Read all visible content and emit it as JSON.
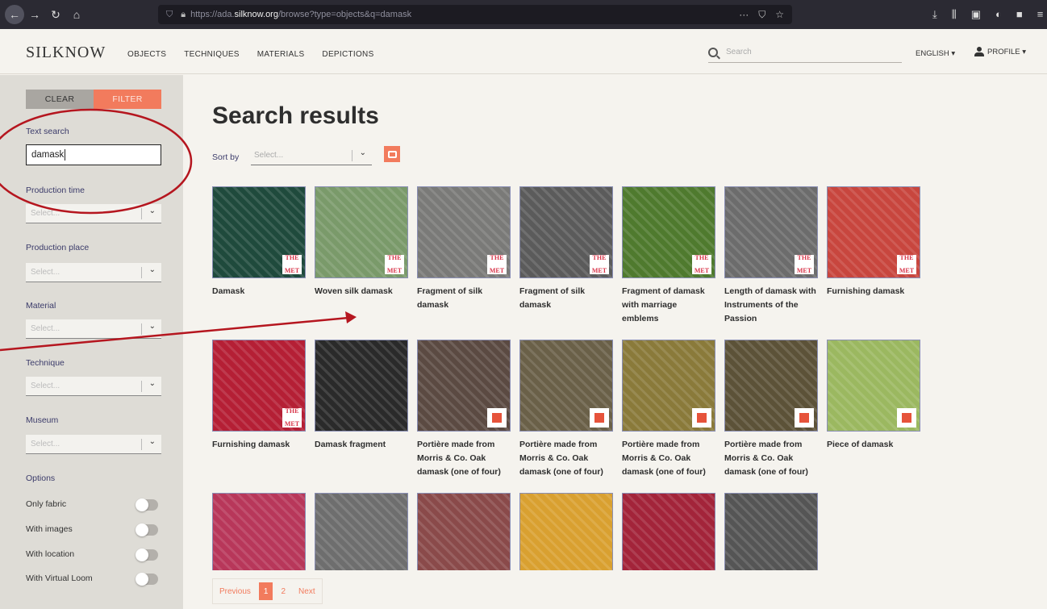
{
  "browser": {
    "url_prefix": "https://ada.",
    "url_host": "silknow.org",
    "url_rest": "/browse?type=objects&q=damask"
  },
  "header": {
    "logo": "SILKNOW",
    "nav": [
      "OBJECTS",
      "TECHNIQUES",
      "MATERIALS",
      "DEPICTIONS"
    ],
    "search_placeholder": "Search",
    "language": "ENGLISH ▾",
    "profile": "PROFILE ▾"
  },
  "sidebar": {
    "clear": "CLEAR",
    "filter": "FILTER",
    "text_search_label": "Text search",
    "text_search_value": "damask",
    "filters": [
      {
        "label": "Production time",
        "placeholder": "Select..."
      },
      {
        "label": "Production place",
        "placeholder": "Select..."
      },
      {
        "label": "Material",
        "placeholder": "Select..."
      },
      {
        "label": "Technique",
        "placeholder": "Select..."
      },
      {
        "label": "Museum",
        "placeholder": "Select..."
      }
    ],
    "options_label": "Options",
    "options": [
      "Only fabric",
      "With images",
      "With location",
      "With Virtual Loom"
    ]
  },
  "main": {
    "title": "Search results",
    "sort_label": "Sort by",
    "sort_placeholder": "Select...",
    "results": [
      {
        "title": "Damask",
        "badge": "met",
        "color": "#1f4a3c"
      },
      {
        "title": "Woven silk damask",
        "badge": "met",
        "color": "#7a9a6a"
      },
      {
        "title": "Fragment of silk damask",
        "badge": "met",
        "color": "#7a7a78"
      },
      {
        "title": "Fragment of silk damask",
        "badge": "met",
        "color": "#5b5b5b"
      },
      {
        "title": "Fragment of damask with marriage emblems",
        "badge": "met",
        "color": "#4f7a2e"
      },
      {
        "title": "Length of damask with Instruments of the Passion",
        "badge": "met",
        "color": "#6c6c6c"
      },
      {
        "title": "Furnishing damask",
        "badge": "met",
        "color": "#c8463e"
      },
      {
        "title": "Furnishing damask",
        "badge": "met",
        "color": "#b51f35"
      },
      {
        "title": "Damask fragment",
        "badge": "none",
        "color": "#2a2a2a"
      },
      {
        "title": "Portière made from Morris & Co. Oak damask (one of four)",
        "badge": "vam",
        "color": "#5b4a42"
      },
      {
        "title": "Portière made from Morris & Co. Oak damask (one of four)",
        "badge": "vam",
        "color": "#6a6048"
      },
      {
        "title": "Portière made from Morris & Co. Oak damask (one of four)",
        "badge": "vam",
        "color": "#8a7a3a"
      },
      {
        "title": "Portière made from Morris & Co. Oak damask (one of four)",
        "badge": "vam",
        "color": "#5c5238"
      },
      {
        "title": "Piece of damask",
        "badge": "vam",
        "color": "#9bb860"
      },
      {
        "title": "",
        "badge": "none",
        "color": "#b8375a"
      },
      {
        "title": "",
        "badge": "none",
        "color": "#6e6e6e"
      },
      {
        "title": "",
        "badge": "none",
        "color": "#8a4a4a"
      },
      {
        "title": "",
        "badge": "none",
        "color": "#d9a030"
      },
      {
        "title": "",
        "badge": "none",
        "color": "#a3243a"
      },
      {
        "title": "",
        "badge": "none",
        "color": "#555555"
      }
    ],
    "met_line1": "THE",
    "met_line2": "MET",
    "pagination": {
      "prev": "Previous",
      "pages": [
        "1",
        "2"
      ],
      "next": "Next"
    }
  },
  "colors": {
    "accent": "#f27b5d",
    "annotation": "#b5161f",
    "sidebar_bg": "#dedcd6",
    "page_bg": "#f5f3ee"
  }
}
